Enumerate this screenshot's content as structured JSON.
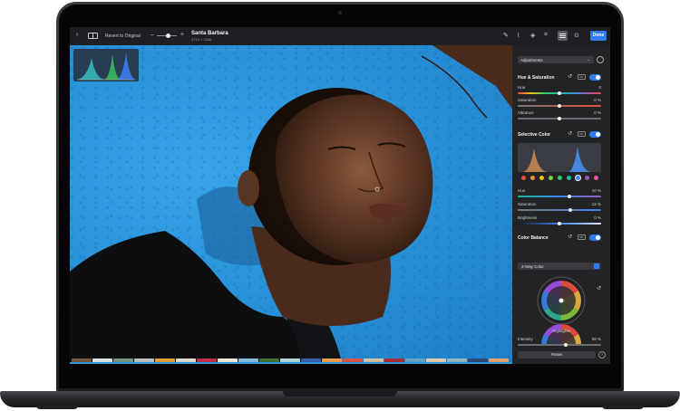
{
  "toolbar": {
    "back_icon": "chevron-left-icon",
    "revert_label": "Revert to Original",
    "zoom_minus": "–",
    "zoom_plus": "+",
    "title": "Santa Barbara",
    "subtitle": "3712 × 2346",
    "done_label": "Done"
  },
  "panel": {
    "dropdown_label": "Adjustments",
    "hue_saturation": {
      "title": "Hue & Saturation",
      "ml": "ML",
      "sliders": [
        {
          "label": "Hue",
          "value": "0",
          "fill": 0.5
        },
        {
          "label": "Saturation",
          "value": "0 %",
          "fill": 0.5
        },
        {
          "label": "Vibrance",
          "value": "0 %",
          "fill": 0.5
        }
      ]
    },
    "selective_color": {
      "title": "Selective Color",
      "ml": "ML",
      "sliders": [
        {
          "label": "Hue",
          "value": "10 %",
          "fill": 0.62
        },
        {
          "label": "Saturation",
          "value": "12 %",
          "fill": 0.63
        },
        {
          "label": "Brightness",
          "value": "0 %",
          "fill": 0.5
        }
      ]
    },
    "color_balance": {
      "title": "Color Balance",
      "mode": "3-Way Color",
      "wheel_label": "Highlights"
    },
    "intensity": {
      "label": "Intensity",
      "value": "58 %",
      "fill": 0.58
    },
    "reset_label": "Reset",
    "help_label": "?"
  },
  "colors": {
    "accent": "#2f7cf6",
    "panel_bg": "#222325",
    "toolbar_bg": "#1e1f22"
  }
}
